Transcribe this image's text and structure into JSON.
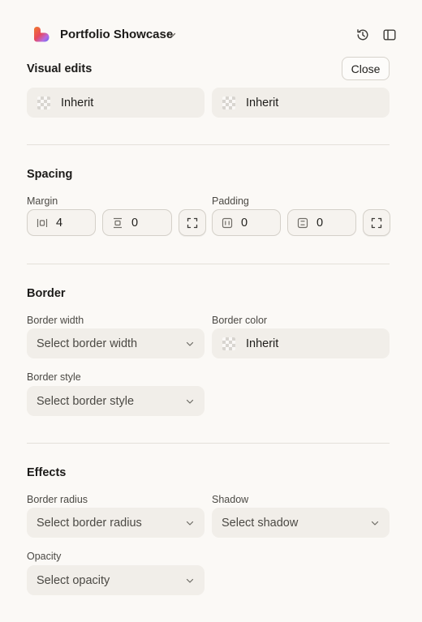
{
  "header": {
    "app_title": "Portfolio Showcase",
    "icons": [
      "heart-logo",
      "chevron-down-icon",
      "history-icon",
      "sidebar-panel-icon"
    ]
  },
  "visual_edits": {
    "title": "Visual edits",
    "close_label": "Close",
    "color_fields": [
      {
        "value": "Inherit"
      },
      {
        "value": "Inherit"
      }
    ]
  },
  "spacing": {
    "title": "Spacing",
    "margin": {
      "label": "Margin",
      "horizontal": "4",
      "vertical": "0"
    },
    "padding": {
      "label": "Padding",
      "horizontal": "0",
      "vertical": "0"
    }
  },
  "border": {
    "title": "Border",
    "width": {
      "label": "Border width",
      "placeholder": "Select border width"
    },
    "color": {
      "label": "Border color",
      "value": "Inherit"
    },
    "style": {
      "label": "Border style",
      "placeholder": "Select border style"
    }
  },
  "effects": {
    "title": "Effects",
    "radius": {
      "label": "Border radius",
      "placeholder": "Select border radius"
    },
    "shadow": {
      "label": "Shadow",
      "placeholder": "Select shadow"
    },
    "opacity": {
      "label": "Opacity",
      "placeholder": "Select opacity"
    }
  },
  "colors": {
    "background": "#fbf9f6",
    "field_fill": "#f1eee9",
    "logo_gradient": [
      "#e85a2c",
      "#f08a3c",
      "#c46bd6",
      "#5b6df0"
    ]
  }
}
